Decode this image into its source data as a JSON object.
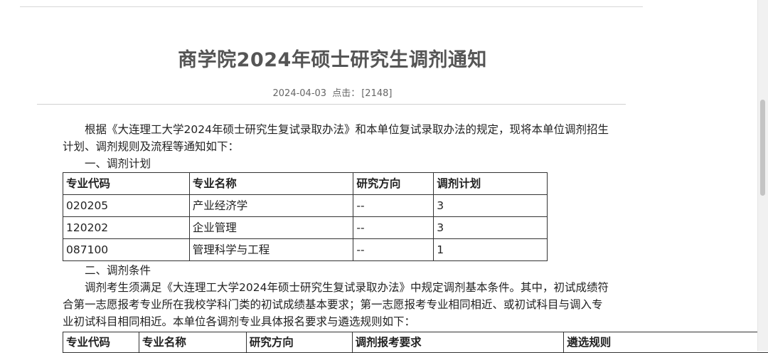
{
  "article": {
    "title": "商学院2024年硕士研究生调剂通知",
    "date": "2024-04-03",
    "clicks_label": "点击：",
    "clicks_value": "[2148]"
  },
  "body": {
    "intro": "根据《大连理工大学2024年硕士研究生复试录取办法》和本单位复试录取办法的规定，现将本单位调剂招生计划、调剂规则及流程等通知如下：",
    "section1": "一、调剂计划",
    "section2": "二、调剂条件",
    "para2": "调剂考生须满足《大连理工大学2024年硕士研究生复试录取办法》中规定调剂基本条件。其中，初试成绩符合第一志愿报考专业所在我校学科门类的初试成绩基本要求；第一志愿报考专业相同相近、或初试科目与调入专业初试科目相同相近。本单位各调剂专业具体报名要求与遴选规则如下："
  },
  "plan_table": {
    "headers": [
      "专业代码",
      "专业名称",
      "研究方向",
      "调剂计划"
    ],
    "rows": [
      [
        "020205",
        "产业经济学",
        "--",
        "3"
      ],
      [
        "120202",
        "企业管理",
        "--",
        "3"
      ],
      [
        "087100",
        "管理科学与工程",
        "--",
        "1"
      ]
    ]
  },
  "rules_table": {
    "headers": [
      "专业代码",
      "专业名称",
      "研究方向",
      "调剂报考要求",
      "遴选规则"
    ]
  }
}
